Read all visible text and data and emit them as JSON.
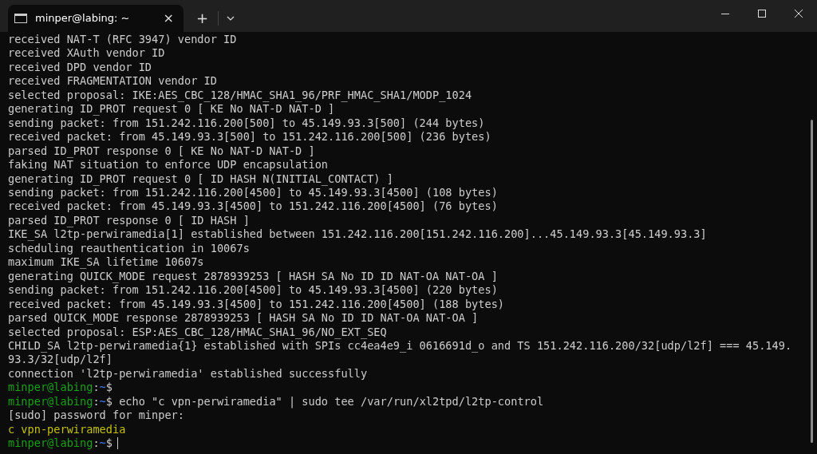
{
  "window": {
    "tab_title": "minper@labing: ~",
    "tab_close": "×",
    "new_tab": "+"
  },
  "terminal": {
    "lines": [
      {
        "kind": "output",
        "text": "received NAT-T (RFC 3947) vendor ID"
      },
      {
        "kind": "output",
        "text": "received XAuth vendor ID"
      },
      {
        "kind": "output",
        "text": "received DPD vendor ID"
      },
      {
        "kind": "output",
        "text": "received FRAGMENTATION vendor ID"
      },
      {
        "kind": "output",
        "text": "selected proposal: IKE:AES_CBC_128/HMAC_SHA1_96/PRF_HMAC_SHA1/MODP_1024"
      },
      {
        "kind": "output",
        "text": "generating ID_PROT request 0 [ KE No NAT-D NAT-D ]"
      },
      {
        "kind": "output",
        "text": "sending packet: from 151.242.116.200[500] to 45.149.93.3[500] (244 bytes)"
      },
      {
        "kind": "output",
        "text": "received packet: from 45.149.93.3[500] to 151.242.116.200[500] (236 bytes)"
      },
      {
        "kind": "output",
        "text": "parsed ID_PROT response 0 [ KE No NAT-D NAT-D ]"
      },
      {
        "kind": "output",
        "text": "faking NAT situation to enforce UDP encapsulation"
      },
      {
        "kind": "output",
        "text": "generating ID_PROT request 0 [ ID HASH N(INITIAL_CONTACT) ]"
      },
      {
        "kind": "output",
        "text": "sending packet: from 151.242.116.200[4500] to 45.149.93.3[4500] (108 bytes)"
      },
      {
        "kind": "output",
        "text": "received packet: from 45.149.93.3[4500] to 151.242.116.200[4500] (76 bytes)"
      },
      {
        "kind": "output",
        "text": "parsed ID_PROT response 0 [ ID HASH ]"
      },
      {
        "kind": "output",
        "text": "IKE_SA l2tp-perwiramedia[1] established between 151.242.116.200[151.242.116.200]...45.149.93.3[45.149.93.3]"
      },
      {
        "kind": "output",
        "text": "scheduling reauthentication in 10067s"
      },
      {
        "kind": "output",
        "text": "maximum IKE_SA lifetime 10607s"
      },
      {
        "kind": "output",
        "text": "generating QUICK_MODE request 2878939253 [ HASH SA No ID ID NAT-OA NAT-OA ]"
      },
      {
        "kind": "output",
        "text": "sending packet: from 151.242.116.200[4500] to 45.149.93.3[4500] (220 bytes)"
      },
      {
        "kind": "output",
        "text": "received packet: from 45.149.93.3[4500] to 151.242.116.200[4500] (188 bytes)"
      },
      {
        "kind": "output",
        "text": "parsed QUICK_MODE response 2878939253 [ HASH SA No ID ID NAT-OA NAT-OA ]"
      },
      {
        "kind": "output",
        "text": "selected proposal: ESP:AES_CBC_128/HMAC_SHA1_96/NO_EXT_SEQ"
      },
      {
        "kind": "output",
        "text": "CHILD_SA l2tp-perwiramedia{1} established with SPIs cc4ea4e9_i 0616691d_o and TS 151.242.116.200/32[udp/l2f] === 45.149."
      },
      {
        "kind": "output",
        "text": "93.3/32[udp/l2f]"
      },
      {
        "kind": "output",
        "text": "connection 'l2tp-perwiramedia' established successfully"
      },
      {
        "kind": "prompt",
        "user_host": "minper@labing",
        "separator": ":",
        "path": "~",
        "symbol": "$"
      },
      {
        "kind": "prompt",
        "user_host": "minper@labing",
        "separator": ":",
        "path": "~",
        "symbol": "$",
        "command": "echo \"c vpn-perwiramedia\" | sudo tee /var/run/xl2tpd/l2tp-control"
      },
      {
        "kind": "output",
        "text": "[sudo] password for minper:"
      },
      {
        "kind": "highlight",
        "text": "c vpn-perwiramedia"
      },
      {
        "kind": "prompt",
        "user_host": "minper@labing",
        "separator": ":",
        "path": "~",
        "symbol": "$",
        "cursor": true
      }
    ]
  }
}
